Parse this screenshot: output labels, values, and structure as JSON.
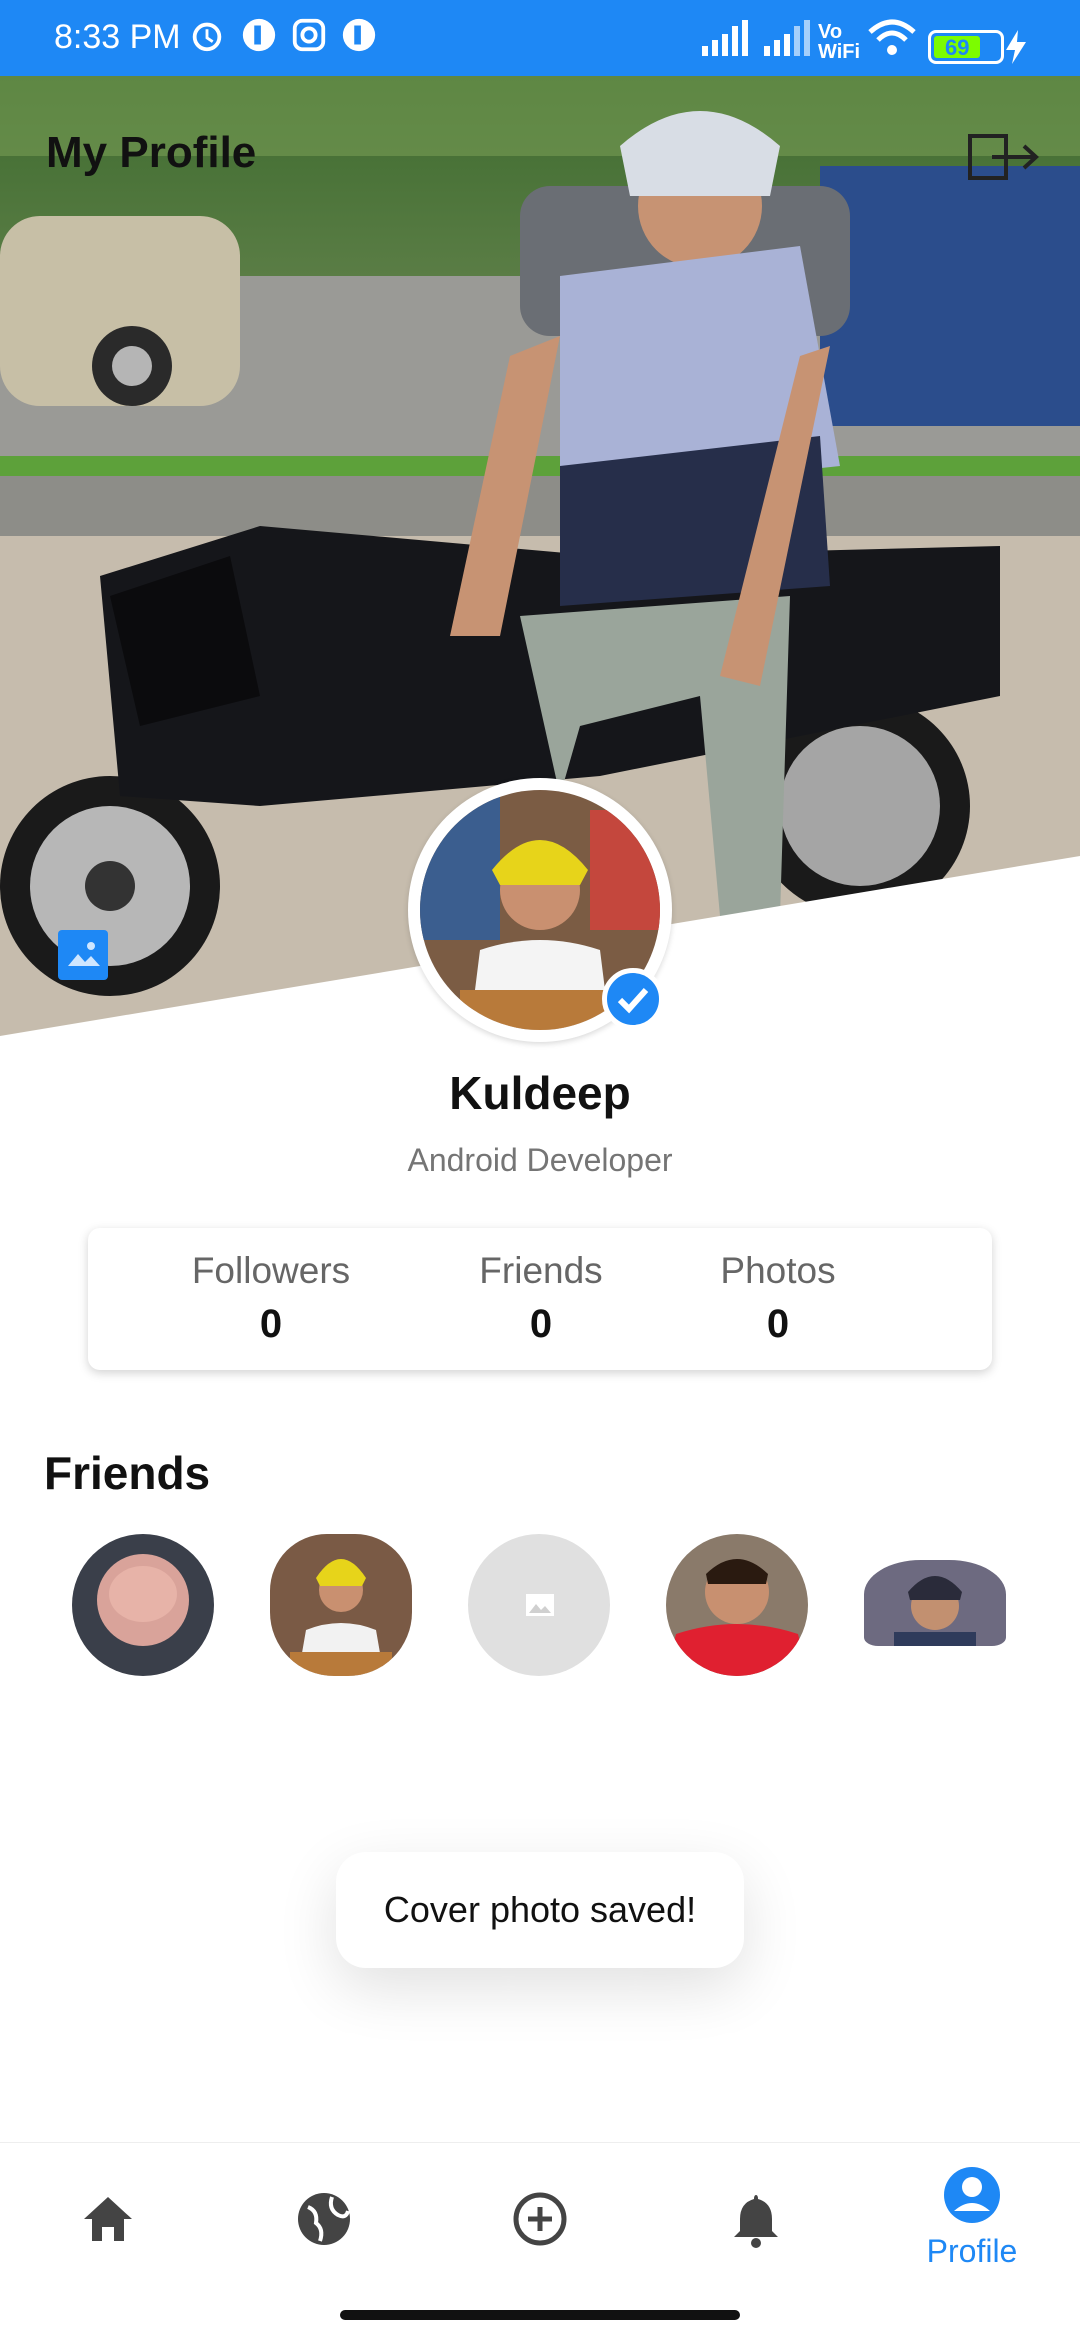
{
  "status_bar": {
    "time": "8:33 PM",
    "battery": "69",
    "icons": [
      "alarm-icon",
      "app-icon",
      "instagram-icon",
      "app-icon",
      "signal-icon",
      "signal-icon",
      "vowifi-icon",
      "wifi-icon",
      "battery-icon",
      "charging-icon"
    ],
    "wifi_label": "Vo\nWiFi"
  },
  "header": {
    "title": "My Profile"
  },
  "profile": {
    "name": "Kuldeep",
    "role": "Android Developer",
    "verified": true
  },
  "stats": [
    {
      "label": "Followers",
      "value": "0"
    },
    {
      "label": "Friends",
      "value": "0"
    },
    {
      "label": "Photos",
      "value": "0"
    }
  ],
  "friends": {
    "heading": "Friends",
    "items": [
      "baby-photo",
      "turban-photo",
      "placeholder-image",
      "red-hoodie-photo",
      "turban-selfie-photo"
    ]
  },
  "toast": {
    "message": "Cover photo saved!"
  },
  "bottom_nav": [
    {
      "icon": "home-icon",
      "label": ""
    },
    {
      "icon": "globe-icon",
      "label": ""
    },
    {
      "icon": "add-circle-icon",
      "label": ""
    },
    {
      "icon": "bell-icon",
      "label": ""
    },
    {
      "icon": "profile-icon",
      "label": "Profile"
    }
  ],
  "colors": {
    "accent": "#1E88F5",
    "inactive_icon": "#444444"
  }
}
